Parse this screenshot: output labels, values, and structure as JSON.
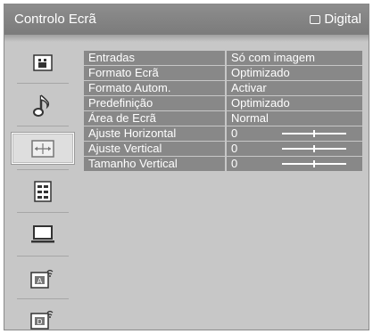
{
  "header": {
    "title": "Controlo Ecrã",
    "source_label": "Digital",
    "source_icon": "monitor-outline-icon"
  },
  "sidebar": {
    "items": [
      {
        "icon": "picture-icon",
        "selected": false
      },
      {
        "icon": "music-note-icon",
        "selected": false
      },
      {
        "icon": "screen-control-icon",
        "selected": true
      },
      {
        "icon": "settings-list-icon",
        "selected": false
      },
      {
        "icon": "pc-monitor-icon",
        "selected": false
      },
      {
        "icon": "analog-broadcast-icon",
        "selected": false
      },
      {
        "icon": "digital-broadcast-icon",
        "selected": false
      }
    ]
  },
  "menu": {
    "rows": [
      {
        "label": "Entradas",
        "value": "Só com imagem"
      },
      {
        "label": "Formato Ecrã",
        "value": "Optimizado"
      },
      {
        "label": "Formato Autom.",
        "value": "Activar"
      },
      {
        "label": "Predefinição",
        "value": "Optimizado"
      },
      {
        "label": "Área de Ecrã",
        "value": "Normal"
      },
      {
        "label": "Ajuste Horizontal",
        "value": "0",
        "slider_fraction": 0.5
      },
      {
        "label": "Ajuste Vertical",
        "value": "0",
        "slider_fraction": 0.5
      },
      {
        "label": "Tamanho Vertical",
        "value": "0",
        "slider_fraction": 0.5
      }
    ]
  },
  "colors": {
    "background": "#c7c7c7",
    "titlebar": "#848484",
    "menu_cell": "#888888",
    "text": "#ffffff"
  }
}
